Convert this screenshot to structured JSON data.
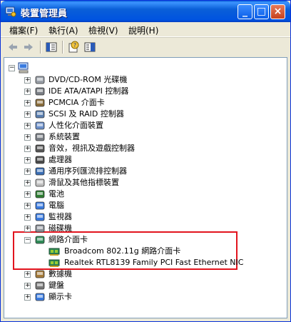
{
  "window": {
    "title": "裝置管理員",
    "controls": {
      "minimize": "_",
      "maximize": "□",
      "close": "×"
    }
  },
  "menu": [
    "檔案(F)",
    "執行(A)",
    "檢視(V)",
    "說明(H)"
  ],
  "toolbar": {
    "icons": [
      "back-icon",
      "forward-icon",
      "tree-view-icon",
      "properties-help-icon",
      "panel-icon"
    ]
  },
  "tree": {
    "root": "",
    "categories": [
      {
        "label": "DVD/CD-ROM 光碟機",
        "expanded": false
      },
      {
        "label": "IDE ATA/ATAPI 控制器",
        "expanded": false
      },
      {
        "label": "PCMCIA 介面卡",
        "expanded": false
      },
      {
        "label": "SCSI 及 RAID 控制器",
        "expanded": false
      },
      {
        "label": "人性化介面裝置",
        "expanded": false
      },
      {
        "label": "系統裝置",
        "expanded": false
      },
      {
        "label": "音效，視訊及遊戲控制器",
        "expanded": false
      },
      {
        "label": "處理器",
        "expanded": false
      },
      {
        "label": "通用序列匯流排控制器",
        "expanded": false
      },
      {
        "label": "滑鼠及其他指標裝置",
        "expanded": false
      },
      {
        "label": "電池",
        "expanded": false
      },
      {
        "label": "電腦",
        "expanded": false
      },
      {
        "label": "監視器",
        "expanded": false
      },
      {
        "label": "磁碟機",
        "expanded": false
      },
      {
        "label": "網路介面卡",
        "expanded": true,
        "children": [
          "Broadcom 802.11g 網路介面卡",
          "Realtek RTL8139 Family PCI Fast Ethernet NIC"
        ]
      },
      {
        "label": "數據機",
        "expanded": false
      },
      {
        "label": "鍵盤",
        "expanded": false
      },
      {
        "label": "顯示卡",
        "expanded": false
      }
    ]
  },
  "colors": {
    "highlight": "#e2141e",
    "titlebar": "#0a5fd8"
  }
}
